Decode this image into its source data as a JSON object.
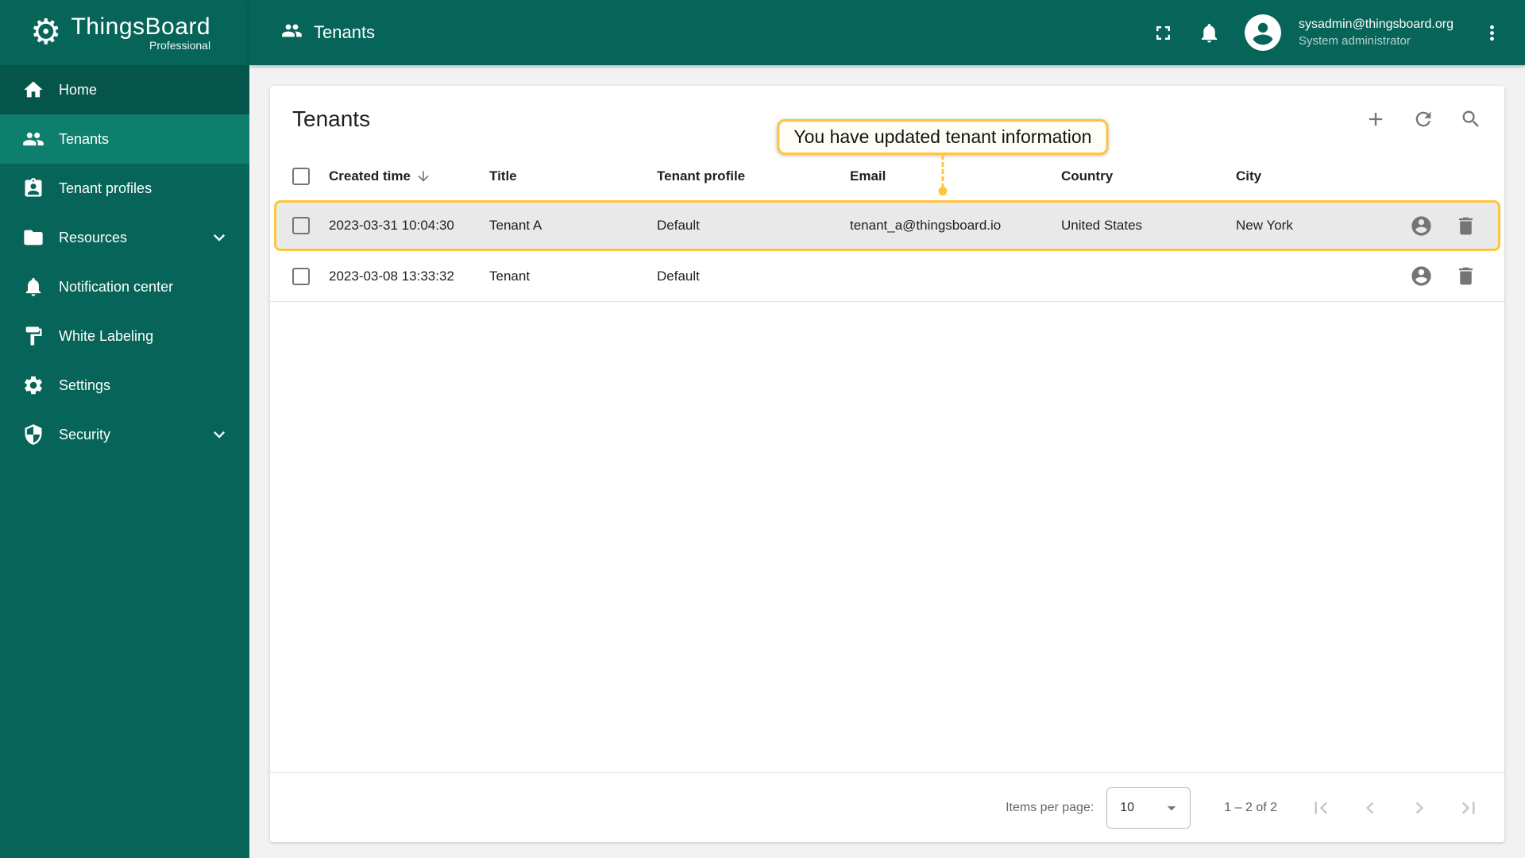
{
  "colors": {
    "primary": "#076459",
    "primary_active": "#0e7e6d",
    "highlight": "#ffc53d"
  },
  "app": {
    "brand": "ThingsBoard",
    "edition": "Professional"
  },
  "topbar": {
    "title": "Tenants",
    "user_email": "sysadmin@thingsboard.org",
    "user_role": "System administrator"
  },
  "sidebar": {
    "items": [
      {
        "label": "Home",
        "icon": "home-icon"
      },
      {
        "label": "Tenants",
        "icon": "tenants-icon",
        "active": true
      },
      {
        "label": "Tenant profiles",
        "icon": "tenant-profiles-icon"
      },
      {
        "label": "Resources",
        "icon": "folder-icon",
        "expandable": true
      },
      {
        "label": "Notification center",
        "icon": "notification-center-icon"
      },
      {
        "label": "White Labeling",
        "icon": "white-labeling-icon"
      },
      {
        "label": "Settings",
        "icon": "settings-icon"
      },
      {
        "label": "Security",
        "icon": "security-icon",
        "expandable": true
      }
    ]
  },
  "main": {
    "title": "Tenants",
    "callout": "You have updated tenant information",
    "table": {
      "columns": [
        "Created time",
        "Title",
        "Tenant profile",
        "Email",
        "Country",
        "City"
      ],
      "rows": [
        {
          "created_time": "2023-03-31 10:04:30",
          "title": "Tenant A",
          "tenant_profile": "Default",
          "email": "tenant_a@thingsboard.io",
          "country": "United States",
          "city": "New York",
          "highlighted": true
        },
        {
          "created_time": "2023-03-08 13:33:32",
          "title": "Tenant",
          "tenant_profile": "Default",
          "email": "",
          "country": "",
          "city": "",
          "highlighted": false
        }
      ]
    },
    "pagination": {
      "items_per_page_label": "Items per page:",
      "page_size": "10",
      "range": "1 – 2 of 2"
    }
  }
}
